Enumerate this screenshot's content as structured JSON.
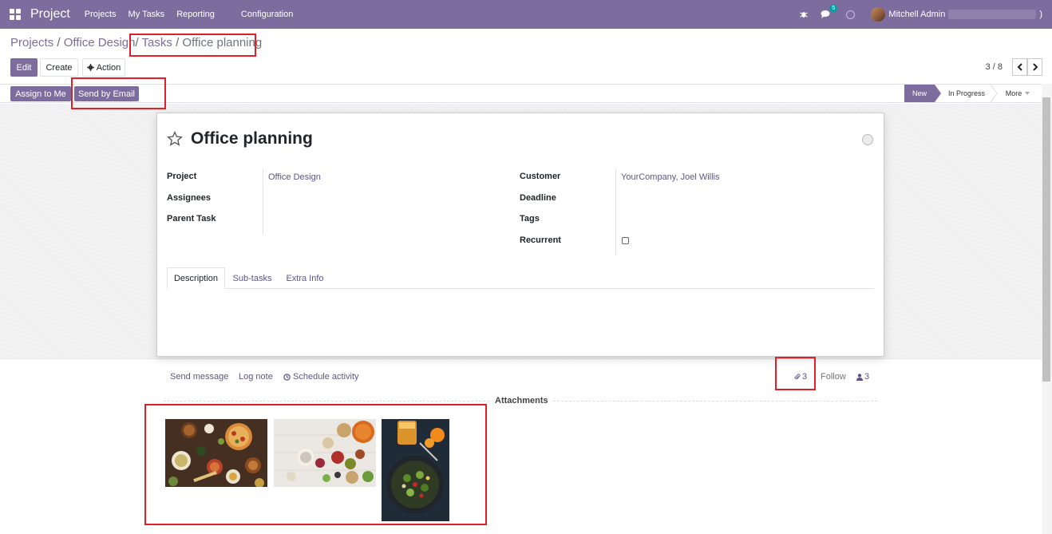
{
  "navbar": {
    "app_name": "Project",
    "menu": [
      "Projects",
      "My Tasks",
      "Reporting",
      "Configuration"
    ],
    "chat_badge": "5",
    "user_name": "Mitchell Admin",
    "user_suffix": ")"
  },
  "breadcrumb": {
    "items": [
      "Projects",
      "Office Design",
      "Tasks"
    ],
    "current": "Office planning",
    "separator": "/"
  },
  "buttons": {
    "edit": "Edit",
    "create": "Create",
    "action": "Action",
    "assign_to_me": "Assign to Me",
    "send_by_email": "Send by Email"
  },
  "pager": {
    "value": "3 / 8"
  },
  "stages": {
    "new": "New",
    "in_progress": "In Progress",
    "more": "More"
  },
  "task": {
    "title": "Office planning",
    "fields_left": [
      {
        "label": "Project",
        "value": "Office Design"
      },
      {
        "label": "Assignees",
        "value": ""
      },
      {
        "label": "Parent Task",
        "value": ""
      }
    ],
    "fields_right": [
      {
        "label": "Customer",
        "value": "YourCompany, Joel Willis"
      },
      {
        "label": "Deadline",
        "value": ""
      },
      {
        "label": "Tags",
        "value": ""
      },
      {
        "label": "Recurrent",
        "value": ""
      }
    ],
    "tabs": [
      "Description",
      "Sub-tasks",
      "Extra Info"
    ]
  },
  "chatter": {
    "send_message": "Send message",
    "log_note": "Log note",
    "schedule_activity": "Schedule activity",
    "attachment_count": "3",
    "follow": "Follow",
    "follower_count": "3",
    "attachments_title": "Attachments"
  },
  "attachments": [
    {
      "name": "food-spread-image",
      "kind": "food-table"
    },
    {
      "name": "ingredients-image",
      "kind": "ingredients"
    },
    {
      "name": "salad-image",
      "kind": "salad"
    }
  ],
  "colors": {
    "brand": "#7c6d9e",
    "link": "#5b5587",
    "highlight": "#e01f26"
  }
}
